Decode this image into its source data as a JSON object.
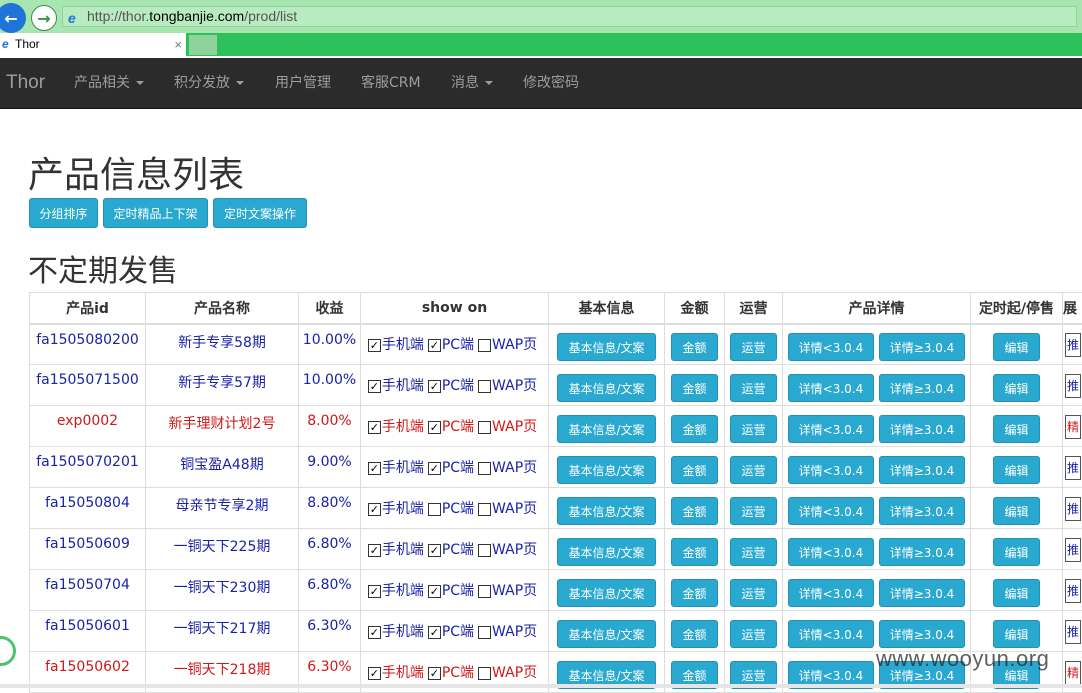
{
  "browser": {
    "url_prefix": "http://thor.",
    "url_host": "tongbanjie.com",
    "url_path": "/prod/list",
    "tab_title": "Thor",
    "tab_close": "×"
  },
  "navbar": {
    "brand": "Thor",
    "items": [
      {
        "label": "产品相关",
        "dropdown": true
      },
      {
        "label": "积分发放",
        "dropdown": true
      },
      {
        "label": "用户管理",
        "dropdown": false
      },
      {
        "label": "客服CRM",
        "dropdown": false
      },
      {
        "label": "消息",
        "dropdown": true
      },
      {
        "label": "修改密码",
        "dropdown": false
      }
    ]
  },
  "page": {
    "title": "产品信息列表",
    "actions": [
      "分组排序",
      "定时精品上下架",
      "定时文案操作"
    ],
    "section_title": "不定期发售"
  },
  "table": {
    "headers": [
      "产品id",
      "产品名称",
      "收益",
      "show on",
      "基本信息",
      "金额",
      "运营",
      "产品详情",
      "定时起/停售",
      "展"
    ],
    "show_on_labels": [
      "手机端",
      "PC端",
      "WAP页"
    ],
    "buttons": {
      "basic": "基本信息/文案",
      "amount": "金额",
      "ops": "运营",
      "detail_old": "详情<3.0.4",
      "detail_new": "详情≥3.0.4",
      "edit": "编辑"
    },
    "rows": [
      {
        "id": "fa1505080200",
        "name": "新手专享58期",
        "yield": "10.00%",
        "mobile": true,
        "pc": true,
        "wap": false,
        "color": "blue",
        "stub": "推"
      },
      {
        "id": "fa1505071500",
        "name": "新手专享57期",
        "yield": "10.00%",
        "mobile": true,
        "pc": true,
        "wap": false,
        "color": "blue",
        "stub": "推"
      },
      {
        "id": "exp0002",
        "name": "新手理财计划2号",
        "yield": "8.00%",
        "mobile": true,
        "pc": true,
        "wap": false,
        "color": "red",
        "stub": "精"
      },
      {
        "id": "fa1505070201",
        "name": "铜宝盈A48期",
        "yield": "9.00%",
        "mobile": true,
        "pc": true,
        "wap": false,
        "color": "blue",
        "stub": "推"
      },
      {
        "id": "fa15050804",
        "name": "母亲节专享2期",
        "yield": "8.80%",
        "mobile": true,
        "pc": false,
        "wap": false,
        "color": "blue",
        "stub": "推"
      },
      {
        "id": "fa15050609",
        "name": "一铜天下225期",
        "yield": "6.80%",
        "mobile": true,
        "pc": true,
        "wap": false,
        "color": "blue",
        "stub": "推"
      },
      {
        "id": "fa15050704",
        "name": "一铜天下230期",
        "yield": "6.80%",
        "mobile": true,
        "pc": true,
        "wap": false,
        "color": "blue",
        "stub": "推"
      },
      {
        "id": "fa15050601",
        "name": "一铜天下217期",
        "yield": "6.30%",
        "mobile": true,
        "pc": true,
        "wap": false,
        "color": "blue",
        "stub": "推"
      },
      {
        "id": "fa15050602",
        "name": "一铜天下218期",
        "yield": "6.30%",
        "mobile": true,
        "pc": true,
        "wap": false,
        "color": "red",
        "stub": "精"
      }
    ]
  },
  "watermark": "www.wooyun.org",
  "colors": {
    "navbar_bg": "#2b2b2b",
    "button_bg": "#2aa9d0",
    "link_blue": "#1a22a8",
    "link_red": "#d01818",
    "addressbar_green": "#a7e6b0",
    "tabbar_green": "#2ec05a"
  }
}
